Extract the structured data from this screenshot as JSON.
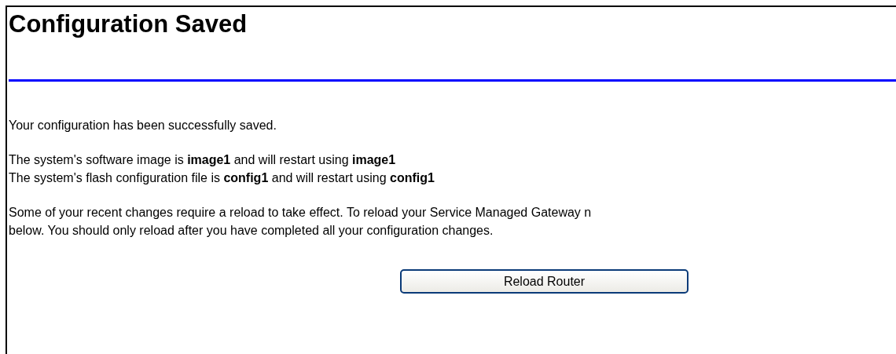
{
  "page": {
    "title": "Configuration Saved"
  },
  "message": "Your configuration has been successfully saved.",
  "status_lines": [
    "The system's software image is **image1** and will restart using **image1**",
    "The system's flash configuration file is **config1** and will restart using **config1**"
  ],
  "notice_lines": [
    "Some of your recent changes require a reload to take effect. To reload your Service Managed Gateway n",
    "below. You should only reload after you have completed all your configuration changes."
  ],
  "buttons": [
    {
      "label": "Reload Router"
    }
  ]
}
